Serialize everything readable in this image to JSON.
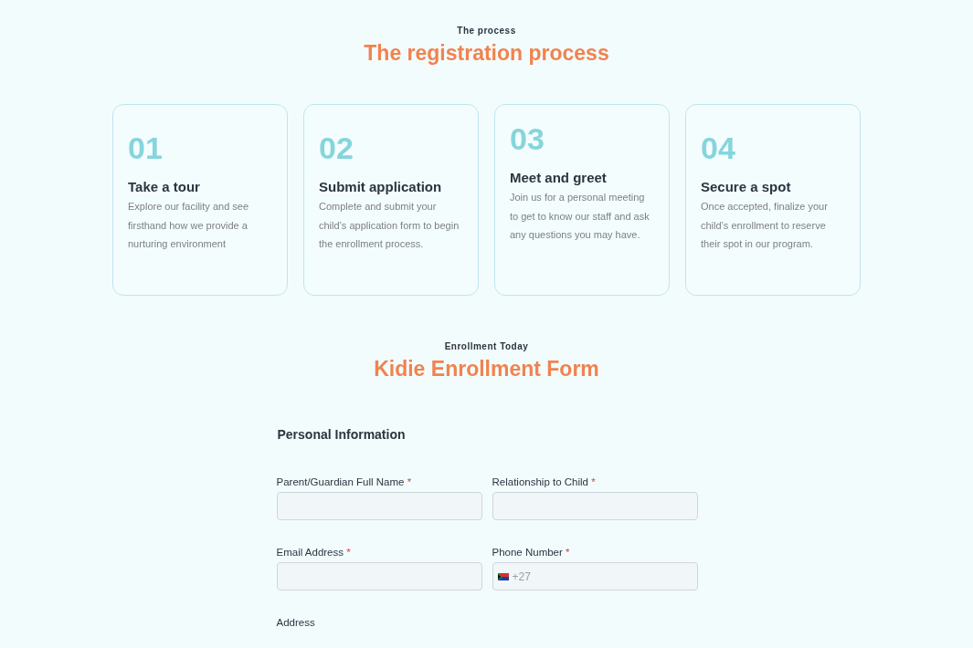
{
  "process_section": {
    "eyebrow": "The process",
    "title": "The registration process"
  },
  "steps": [
    {
      "number": "01",
      "title": "Take a tour",
      "text": "Explore our facility and see firsthand how we provide a nurturing environment",
      "raised": false
    },
    {
      "number": "02",
      "title": "Submit application",
      "text": "Complete and submit your child’s application form to begin the enrollment process.",
      "raised": false
    },
    {
      "number": "03",
      "title": "Meet and greet",
      "text": "Join us for a personal meeting to get to know our staff and ask any questions you may have.",
      "raised": true
    },
    {
      "number": "04",
      "title": "Secure a spot",
      "text": "Once accepted, finalize your child’s enrollment to reserve their spot in our program.",
      "raised": false
    }
  ],
  "form_section": {
    "eyebrow": "Enrollment Today",
    "title": "Kidie Enrollment Form",
    "heading": "Personal Information",
    "fields": [
      {
        "label": "Parent/Guardian Full Name",
        "required_mark": "*",
        "kind": "text"
      },
      {
        "label": "Relationship to Child",
        "required_mark": "*",
        "kind": "text"
      },
      {
        "label": "Email Address",
        "required_mark": "*",
        "kind": "text"
      },
      {
        "label": "Phone Number",
        "required_mark": "*",
        "kind": "phone",
        "placeholder": "+27"
      },
      {
        "label": "Address",
        "kind": "label-only"
      }
    ]
  }
}
